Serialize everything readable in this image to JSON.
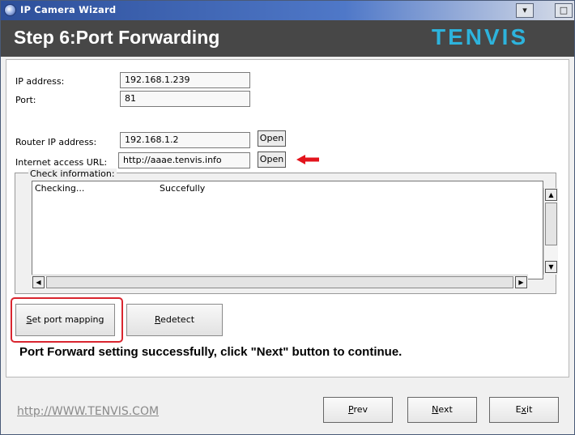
{
  "window": {
    "title": "IP Camera Wizard",
    "minimize_label": "▾",
    "maximize_label": "□"
  },
  "header": {
    "title": "Step 6:Port Forwarding",
    "logo": "TENVIS"
  },
  "form": {
    "ip_label": "IP address:",
    "ip_value": "192.168.1.239",
    "port_label": "Port:",
    "port_value": "81",
    "router_label": "Router IP address:",
    "router_value": "192.168.1.2",
    "router_open": "Open",
    "url_label": "Internet access URL:",
    "url_value": "http://aaae.tenvis.info",
    "url_open": "Open"
  },
  "check": {
    "legend": "Check information:",
    "rows": [
      {
        "item": "Checking...",
        "result": "Succefully"
      }
    ]
  },
  "actions": {
    "set_port_mapping_first": "S",
    "set_port_mapping_rest": "et port mapping",
    "redetect_first": "R",
    "redetect_rest": "edetect"
  },
  "status": {
    "message": "Port Forward setting successfully, click \"Next\" button to continue."
  },
  "footer": {
    "link": "http://WWW.TENVIS.COM",
    "prev_first": "P",
    "prev_rest": "rev",
    "next_first": "N",
    "next_rest": "ext",
    "exit_a": "E",
    "exit_u": "x",
    "exit_b": "it"
  },
  "colors": {
    "accent_logo": "#2db3dc",
    "header_bg": "#474747",
    "highlight": "#d9252f"
  }
}
